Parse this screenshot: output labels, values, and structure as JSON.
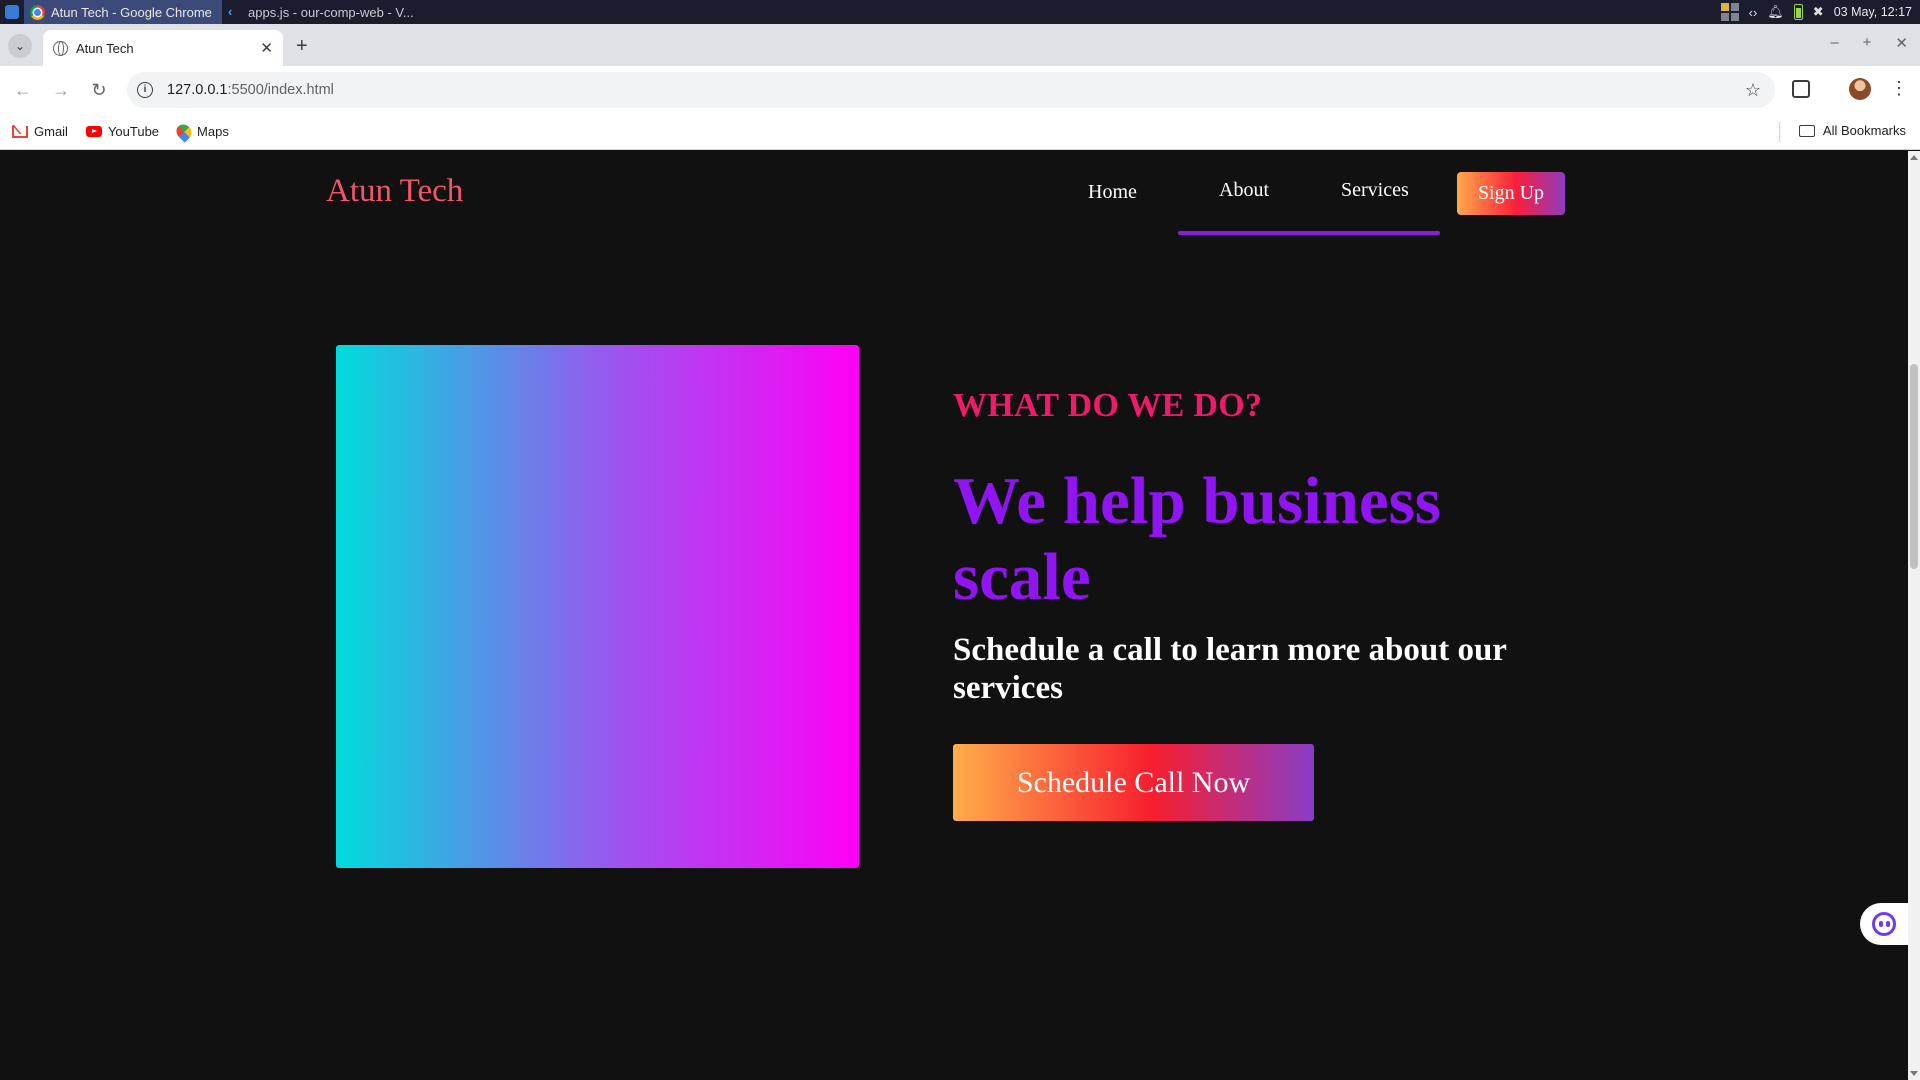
{
  "taskbar": {
    "items": [
      {
        "label": "Atun Tech - Google Chrome",
        "icon": "chrome-icon"
      },
      {
        "label": "apps.js - our-comp-web - V...",
        "icon": "vscode-icon"
      }
    ],
    "datetime": "03 May, 12:17"
  },
  "browser": {
    "tab_title": "Atun Tech",
    "url_host": "127.0.0.1",
    "url_path": ":5500/index.html",
    "bookmarks": [
      "Gmail",
      "YouTube",
      "Maps"
    ],
    "all_bookmarks": "All Bookmarks"
  },
  "site": {
    "logo": "Atun Tech",
    "nav": {
      "home": "Home",
      "about": "About",
      "services": "Services",
      "signup": "Sign Up"
    },
    "hero": {
      "eyebrow": "WHAT DO WE DO?",
      "headline": "We help business scale",
      "subhead": "Schedule a call to learn more about our services",
      "cta": "Schedule Call Now"
    },
    "colors": {
      "logo": "#f0556a",
      "eyebrow": "#f01a6a",
      "headline": "#9114f2",
      "nav_underline": "#8a1de0",
      "background": "#111112",
      "hero_gradient": [
        "#00dcdc",
        "#a051f0",
        "#ff00f5"
      ],
      "button_gradient": [
        "#ffa94a",
        "#f81e3c",
        "#8e3cc0"
      ]
    }
  }
}
